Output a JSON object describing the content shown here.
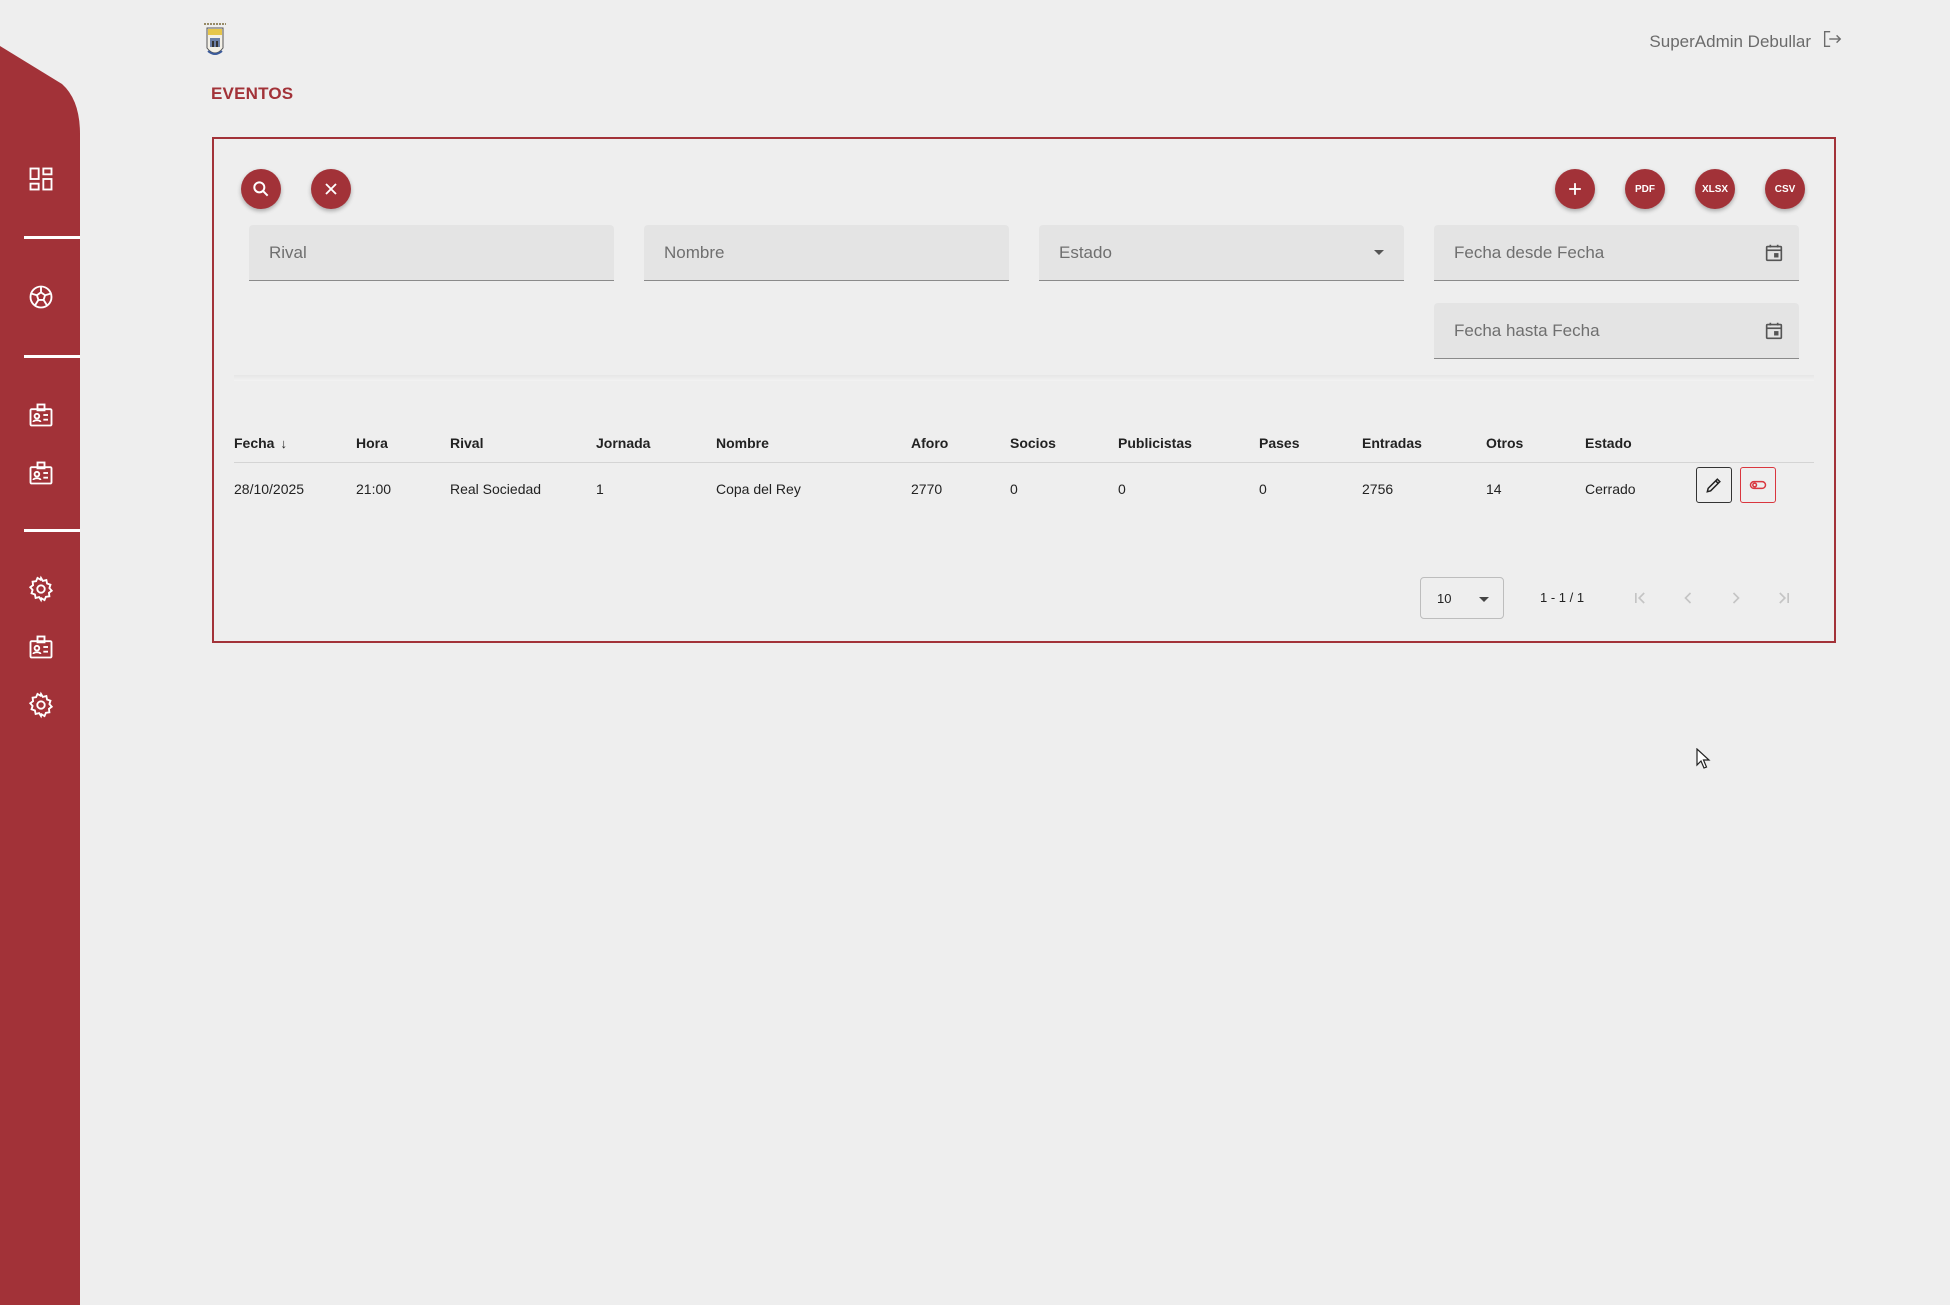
{
  "header": {
    "page_title": "EVENTOS",
    "user_name": "SuperAdmin Debullar",
    "logout_icon": "logout-icon",
    "logo_icon": "club-crest-logo"
  },
  "sidebar": {
    "items": [
      {
        "icon": "dashboard-icon"
      },
      {
        "icon": "soccer-ball-icon"
      },
      {
        "icon": "id-card-icon"
      },
      {
        "icon": "id-card-icon"
      },
      {
        "icon": "gear-icon"
      },
      {
        "icon": "id-card-icon"
      },
      {
        "icon": "gear-icon"
      }
    ]
  },
  "toolbar": {
    "search_icon": "search-icon",
    "clear_icon": "close-icon",
    "add_icon": "plus-icon",
    "pdf_label": "PDF",
    "xlsx_label": "XLSX",
    "csv_label": "CSV"
  },
  "filters": {
    "rival_placeholder": "Rival",
    "nombre_placeholder": "Nombre",
    "estado_label": "Estado",
    "fecha_desde_placeholder": "Fecha desde Fecha",
    "fecha_hasta_placeholder": "Fecha hasta Fecha"
  },
  "table": {
    "columns": [
      "Fecha",
      "Hora",
      "Rival",
      "Jornada",
      "Nombre",
      "Aforo",
      "Socios",
      "Publicistas",
      "Pases",
      "Entradas",
      "Otros",
      "Estado"
    ],
    "sort_indicator": "↓",
    "rows": [
      {
        "fecha": "28/10/2025",
        "hora": "21:00",
        "rival": "Real Sociedad",
        "jornada": "1",
        "nombre": "Copa del Rey",
        "aforo": "2770",
        "socios": "0",
        "publicistas": "0",
        "pases": "0",
        "entradas": "2756",
        "otros": "14",
        "estado": "Cerrado"
      }
    ]
  },
  "paginator": {
    "page_size": "10",
    "range": "1 - 1 / 1"
  },
  "colors": {
    "brand": "#a23238",
    "background": "#eeeeee"
  }
}
